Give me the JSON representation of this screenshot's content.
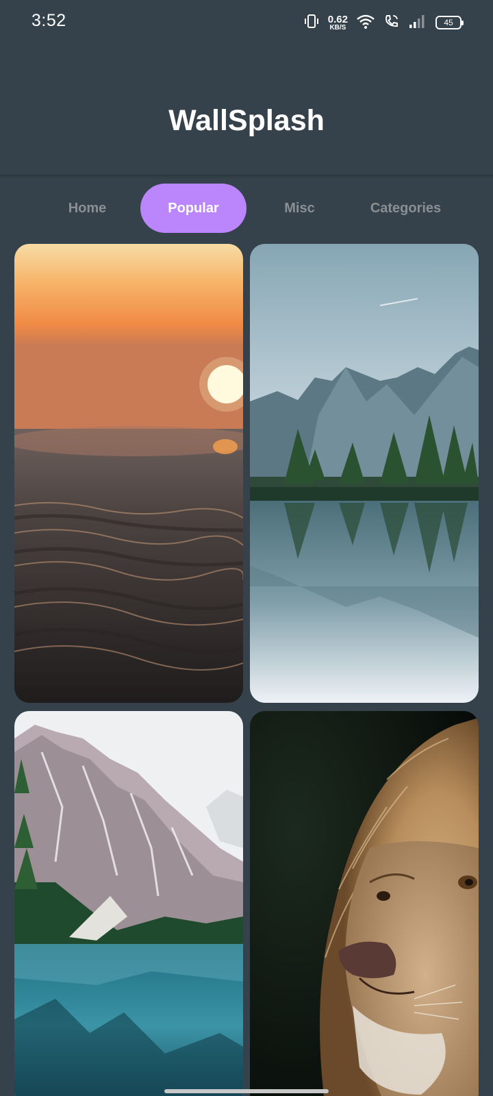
{
  "status_bar": {
    "time": "3:52",
    "net_speed_value": "0.62",
    "net_speed_unit": "KB/S",
    "battery": "45",
    "icons": [
      "vibrate-icon",
      "wifi-icon",
      "wifi-call-icon",
      "signal-icon",
      "battery-icon"
    ]
  },
  "app": {
    "title": "WallSplash"
  },
  "tabs": [
    {
      "label": "Home",
      "active": false
    },
    {
      "label": "Popular",
      "active": true
    },
    {
      "label": "Misc",
      "active": false
    },
    {
      "label": "Categories",
      "active": false
    }
  ],
  "wallpapers": [
    {
      "subject": "ocean-sunset"
    },
    {
      "subject": "mountain-lake-reflection"
    },
    {
      "subject": "alpine-lake-mountain"
    },
    {
      "subject": "lion-portrait"
    }
  ],
  "colors": {
    "background": "#36424b",
    "accent": "#bb86fc",
    "tab_inactive": "#8a8f94"
  }
}
